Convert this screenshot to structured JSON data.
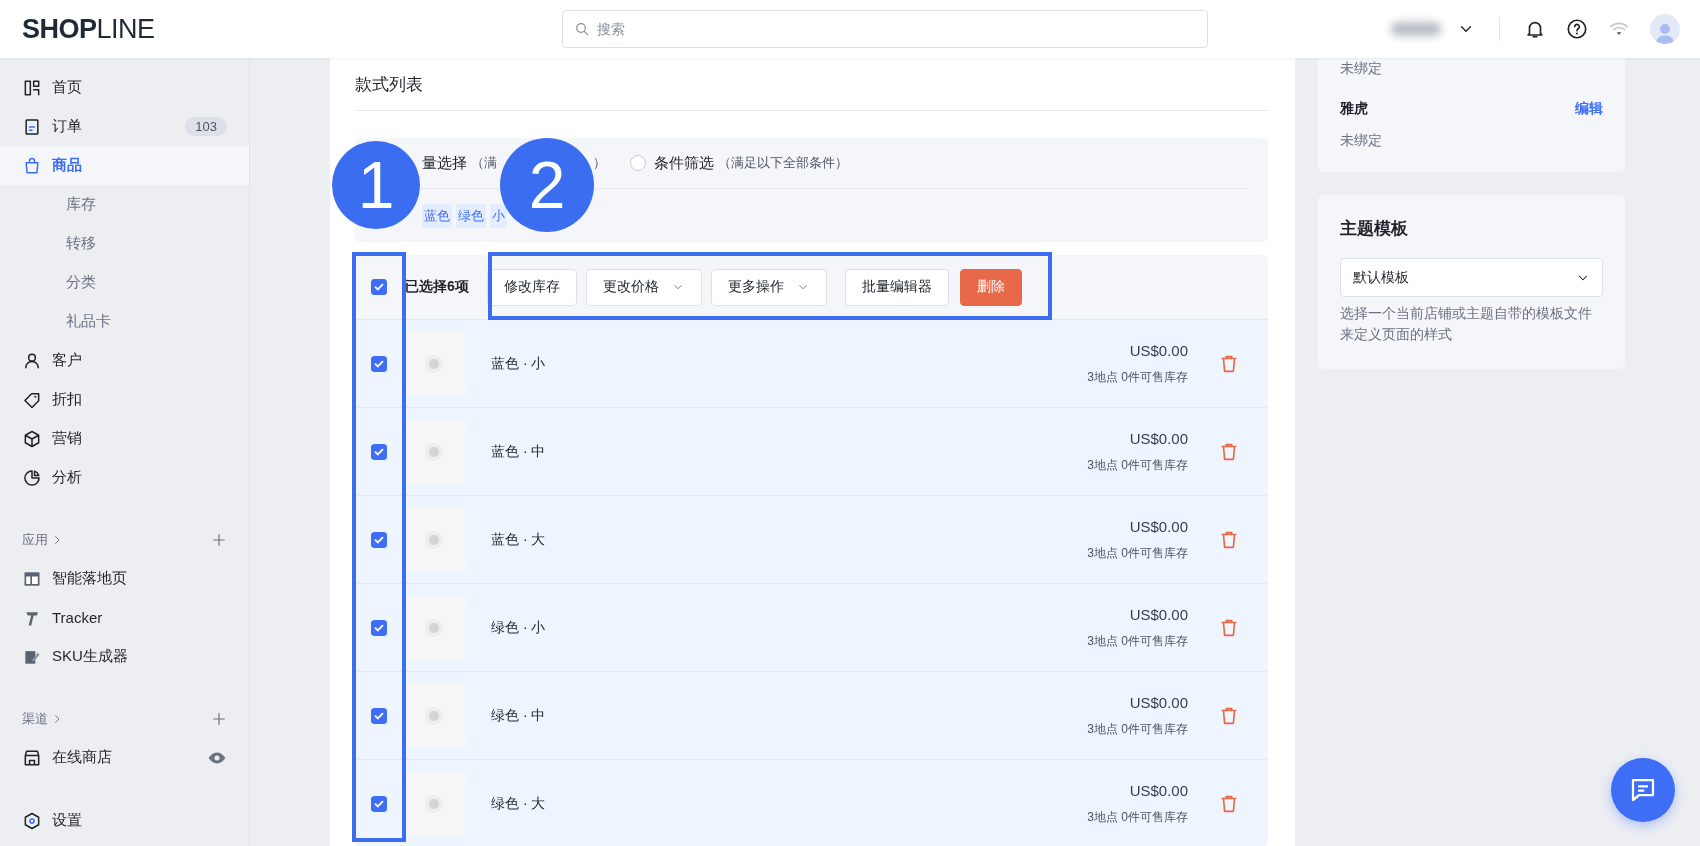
{
  "header": {
    "logo": "**SHOP**LINE",
    "search": {
      "placeholder": "搜索"
    }
  },
  "sidebar": {
    "items": [
      {
        "label": "首页",
        "selected": false
      },
      {
        "label": "订单",
        "badge": "103",
        "selected": false
      },
      {
        "label": "商品",
        "selected": true,
        "children": [
          {
            "label": "库存",
            "selected": false
          },
          {
            "label": "转移",
            "selected": false
          },
          {
            "label": "分类",
            "selected": false
          },
          {
            "label": "礼品卡",
            "selected": false
          }
        ]
      },
      {
        "label": "客户",
        "selected": false
      },
      {
        "label": "折扣",
        "selected": false
      },
      {
        "label": "营销",
        "selected": false
      },
      {
        "label": "分析",
        "selected": false
      }
    ],
    "sections": [
      {
        "title": "应用",
        "items": [
          {
            "label": "智能落地页",
            "selected": false
          },
          {
            "label": "Tracker",
            "selected": false
          },
          {
            "label": "SKU生成器",
            "selected": false
          }
        ]
      },
      {
        "title": "渠道",
        "items": [
          {
            "label": "在线商店",
            "selected": false
          }
        ]
      }
    ],
    "footer": {
      "label": "设置"
    }
  },
  "variants": {
    "title": "款式列表",
    "filter": {
      "options": [
        {
          "label": "量选择",
          "hint": "（满",
          "hint_end": "）"
        },
        {
          "label": "条件筛选",
          "hint": "（满足以下全部条件）",
          "selected": false
        }
      ],
      "tags": [
        "蓝色",
        "绿色",
        "小"
      ]
    },
    "bulk": {
      "checked": true,
      "count": "已选择6项",
      "actions": [
        {
          "label": "修改库存",
          "kind": "button"
        },
        {
          "label": "更改价格",
          "kind": "dropdown"
        },
        {
          "label": "更多操作",
          "kind": "dropdown"
        },
        {
          "label": "批量编辑器",
          "kind": "button"
        },
        {
          "label": "删除",
          "kind": "danger"
        }
      ]
    },
    "rows": [
      {
        "name": "蓝色 · 小",
        "price": "US$0.00",
        "stock": "3地点 0件可售库存",
        "checked": true
      },
      {
        "name": "蓝色 · 中",
        "price": "US$0.00",
        "stock": "3地点 0件可售库存",
        "checked": true
      },
      {
        "name": "蓝色 · 大",
        "price": "US$0.00",
        "stock": "3地点 0件可售库存",
        "checked": true
      },
      {
        "name": "绿色 · 小",
        "price": "US$0.00",
        "stock": "3地点 0件可售库存",
        "checked": true
      },
      {
        "name": "绿色 · 中",
        "price": "US$0.00",
        "stock": "3地点 0件可售库存",
        "checked": true
      },
      {
        "name": "绿色 · 大",
        "price": "US$0.00",
        "stock": "3地点 0件可售库存",
        "checked": true
      }
    ]
  },
  "right_panel": {
    "channels": [
      {
        "status": "未绑定"
      },
      {
        "name": "雅虎",
        "action": "编辑",
        "status": "未绑定"
      }
    ],
    "theme": {
      "title": "主题模板",
      "select": {
        "value": "默认模板"
      },
      "help": "选择一个当前店铺或主题自带的模板文件来定义页面的样式"
    }
  },
  "annotations": [
    {
      "number": "1"
    },
    {
      "number": "2"
    }
  ]
}
